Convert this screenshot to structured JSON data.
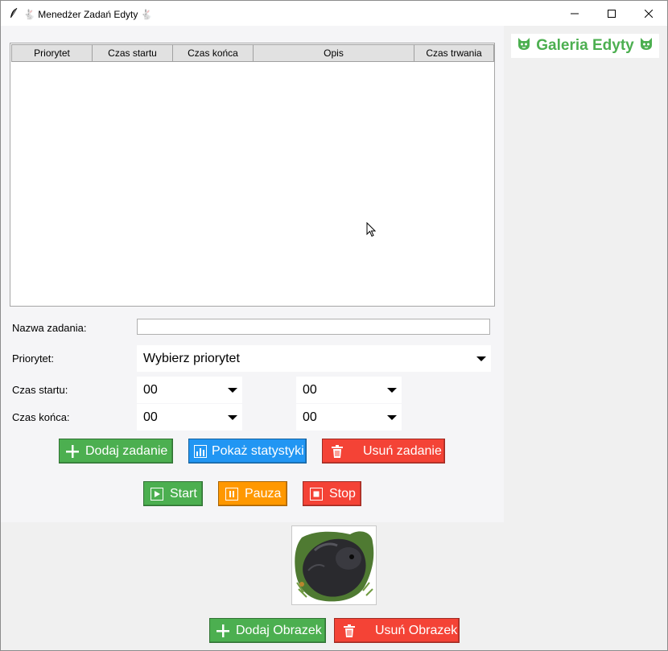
{
  "window": {
    "title": "🐇 Menedżer Zadań Edyty 🐇"
  },
  "table": {
    "columns": [
      "Priorytet",
      "Czas startu",
      "Czas końca",
      "Opis",
      "Czas trwania"
    ],
    "rows": []
  },
  "form": {
    "name_label": "Nazwa zadania:",
    "name_value": "",
    "priority_label": "Priorytet:",
    "priority_value": "Wybierz priorytet",
    "start_label": "Czas startu:",
    "start_hour": "00",
    "start_minute": "00",
    "end_label": "Czas końca:",
    "end_hour": "00",
    "end_minute": "00"
  },
  "buttons": {
    "add_task": "Dodaj zadanie",
    "show_stats": "Pokaż statystyki",
    "delete_task": "Usuń zadanie",
    "start": "Start",
    "pause": "Pauza",
    "stop": "Stop",
    "add_image": "Dodaj Obrazek",
    "delete_image": "Usuń Obrazek"
  },
  "gallery": {
    "title": "Galeria Edyty",
    "icon": "cat-face-icon"
  },
  "colors": {
    "green": "#4caf50",
    "blue": "#2196f3",
    "red": "#f44336",
    "orange": "#ff9800"
  }
}
